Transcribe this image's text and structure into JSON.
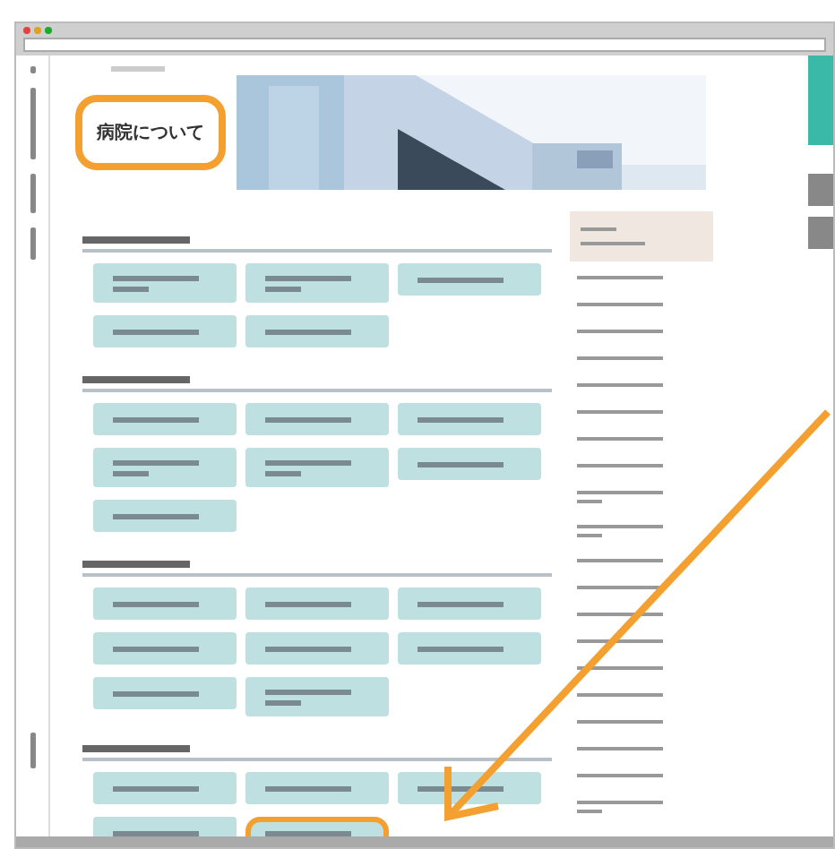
{
  "page": {
    "title": "病院について",
    "title_circled": true
  },
  "sections": [
    {
      "tiles": [
        {
          "kind": "double",
          "circled": false
        },
        {
          "kind": "double",
          "circled": false
        },
        {
          "kind": "single",
          "circled": false
        },
        {
          "kind": "single",
          "circled": false
        },
        {
          "kind": "single",
          "circled": false
        }
      ]
    },
    {
      "tiles": [
        {
          "kind": "single",
          "circled": false
        },
        {
          "kind": "single",
          "circled": false
        },
        {
          "kind": "single",
          "circled": false
        },
        {
          "kind": "double",
          "circled": false
        },
        {
          "kind": "double",
          "circled": false
        },
        {
          "kind": "single",
          "circled": false
        },
        {
          "kind": "single",
          "circled": false
        }
      ]
    },
    {
      "tiles": [
        {
          "kind": "single",
          "circled": false
        },
        {
          "kind": "single",
          "circled": false
        },
        {
          "kind": "single",
          "circled": false
        },
        {
          "kind": "single",
          "circled": false
        },
        {
          "kind": "single",
          "circled": false
        },
        {
          "kind": "single",
          "circled": false
        },
        {
          "kind": "single",
          "circled": false
        },
        {
          "kind": "double",
          "circled": false
        }
      ]
    },
    {
      "tiles": [
        {
          "kind": "single",
          "circled": false
        },
        {
          "kind": "single",
          "circled": false
        },
        {
          "kind": "single",
          "circled": false
        },
        {
          "kind": "single",
          "circled": false
        },
        {
          "kind": "single",
          "circled": true
        }
      ]
    }
  ],
  "sidebar": {
    "items": [
      {
        "kind": "single"
      },
      {
        "kind": "single"
      },
      {
        "kind": "single"
      },
      {
        "kind": "single"
      },
      {
        "kind": "single"
      },
      {
        "kind": "single"
      },
      {
        "kind": "single"
      },
      {
        "kind": "single"
      },
      {
        "kind": "double"
      },
      {
        "kind": "double"
      },
      {
        "kind": "single"
      },
      {
        "kind": "single"
      },
      {
        "kind": "single"
      },
      {
        "kind": "single"
      },
      {
        "kind": "single"
      },
      {
        "kind": "single"
      },
      {
        "kind": "single"
      },
      {
        "kind": "single"
      },
      {
        "kind": "single"
      },
      {
        "kind": "double"
      }
    ]
  },
  "annotation": {
    "arrow": true
  }
}
